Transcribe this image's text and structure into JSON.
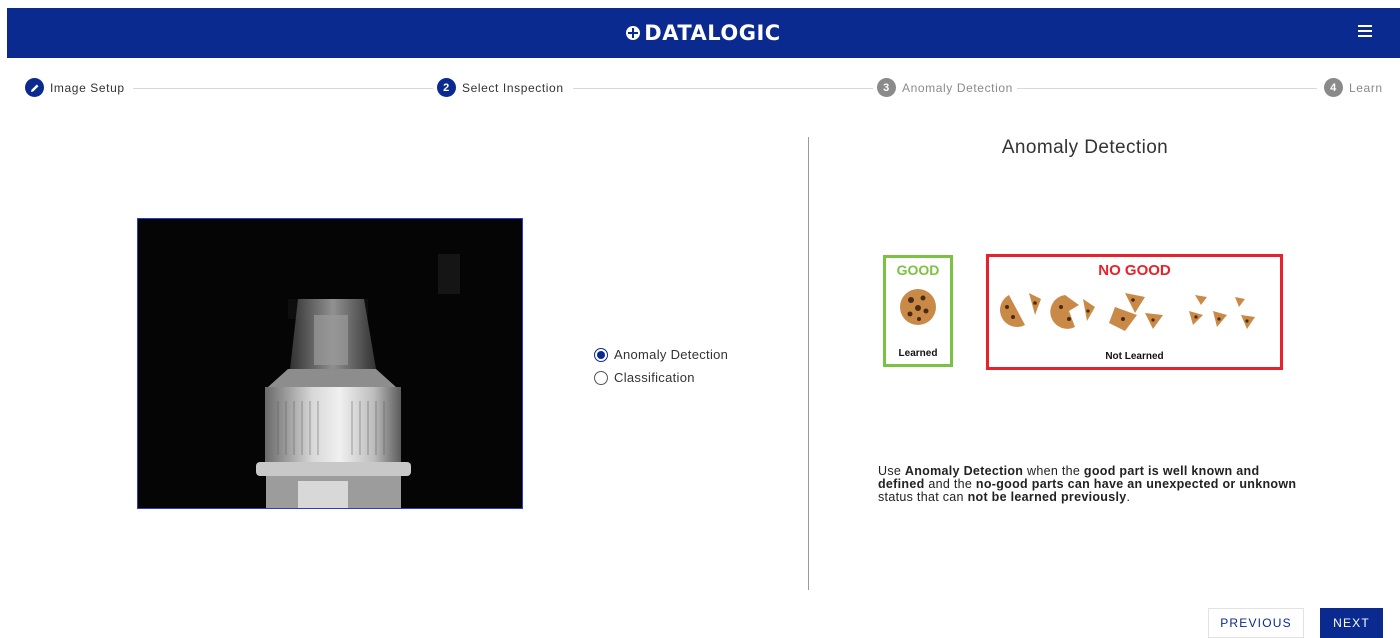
{
  "header": {
    "logo_text": "DATALOGIC",
    "brand_color": "#0a2a8f",
    "menu_icon": "hamburger-menu-icon"
  },
  "stepper": {
    "steps": [
      {
        "number": "",
        "label": "Image Setup",
        "state": "done",
        "icon": "pencil-icon"
      },
      {
        "number": "2",
        "label": "Select Inspection",
        "state": "active"
      },
      {
        "number": "3",
        "label": "Anomaly Detection",
        "state": "inactive"
      },
      {
        "number": "4",
        "label": "Learn",
        "state": "inactive"
      }
    ]
  },
  "inspection": {
    "options": [
      {
        "label": "Anomaly Detection",
        "selected": true
      },
      {
        "label": "Classification",
        "selected": false
      }
    ]
  },
  "info": {
    "title": "Anomaly Detection",
    "good_label": "GOOD",
    "good_caption": "Learned",
    "no_good_label": "NO GOOD",
    "no_good_caption": "Not Learned",
    "good_color": "#7cc242",
    "no_good_color": "#e8222a",
    "desc_parts": [
      "Use ",
      "Anomaly Detection",
      " when the ",
      "good part is well known and defined",
      " and the ",
      "no-good parts can have an unexpected or unknown",
      " status that can ",
      "not be learned previously",
      "."
    ]
  },
  "footer": {
    "previous_label": "PREVIOUS",
    "next_label": "NEXT"
  }
}
